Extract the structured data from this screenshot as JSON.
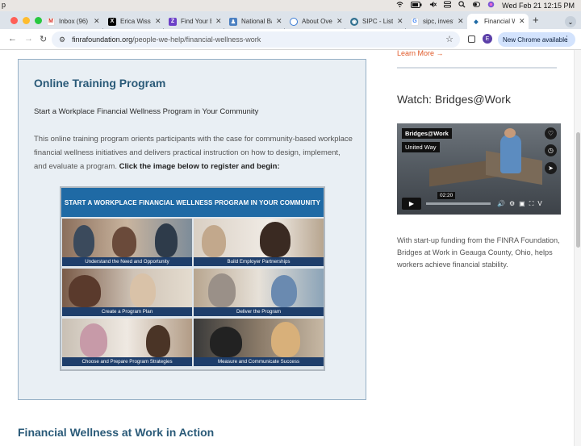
{
  "menubar": {
    "apple": "p",
    "datetime": "Wed Feb 21  12:15 PM"
  },
  "tabs": [
    {
      "title": "Inbox (96)",
      "favicon": "gmail-icon",
      "color": "#d93025"
    },
    {
      "title": "Erica Wissin",
      "favicon": "x-icon",
      "color": "#000000"
    },
    {
      "title": "Find Your B",
      "favicon": "z-icon",
      "color": "#6b3fc7"
    },
    {
      "title": "National Ba",
      "favicon": "person-icon",
      "color": "#4a7fc1"
    },
    {
      "title": "About Over",
      "favicon": "chrome-icon",
      "color": "#3a7bd5"
    },
    {
      "title": "SIPC - List",
      "favicon": "sipc-icon",
      "color": "#2f6f8f"
    },
    {
      "title": "sipc, invest",
      "favicon": "google-icon",
      "color": "#4285f4"
    },
    {
      "title": "Financial W",
      "favicon": "finra-icon",
      "color": "#1f6aa5",
      "active": true
    }
  ],
  "toolbar": {
    "url_domain": "finrafoundation.org",
    "url_path": "/people-we-help/financial-wellness-work",
    "profile_initial": "E",
    "update_label": "New Chrome available"
  },
  "main": {
    "card_title": "Online Training Program",
    "card_subtitle": "Start a Workplace Financial Wellness Program in Your Community",
    "card_desc": "This online training program orients participants with the case for community-based workplace financial wellness initiatives and delivers practical instruction on how to design, implement, and evaluate a program.",
    "card_desc_bold": "Click the image below to register and begin:",
    "image_banner": "START A WORKPLACE FINANCIAL WELLNESS PROGRAM IN YOUR COMMUNITY",
    "image_cells": [
      "Understand the Need and Opportunity",
      "Build Employer Partnerships",
      "Create a Program Plan",
      "Deliver the Program",
      "Choose and Prepare Program Strategies",
      "Measure and Communicate Success"
    ],
    "bottom_heading": "Financial Wellness at Work in Action"
  },
  "sidebar": {
    "learn_more": "Learn More →",
    "watch_title": "Watch: Bridges@Work",
    "video_tag1": "Bridges@Work",
    "video_tag2": "United Way",
    "video_time": "02:20",
    "caption": "With start-up funding from the FINRA Foundation, Bridges at Work in Geauga County, Ohio, helps workers achieve financial stability."
  }
}
